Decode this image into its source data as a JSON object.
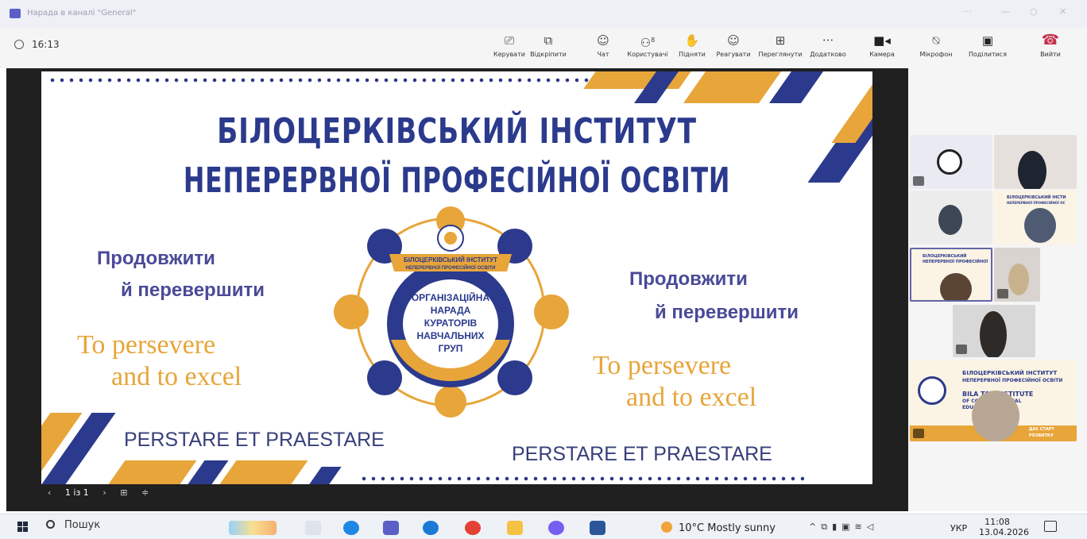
{
  "window": {
    "title": "Нарада в каналі \"General\""
  },
  "toolbar": {
    "timer": "16:13",
    "buttons": [
      {
        "id": "control",
        "label": "Керувати",
        "icon": "present-control-icon"
      },
      {
        "id": "popout",
        "label": "Відкріпити",
        "icon": "popout-icon"
      },
      {
        "id": "chat",
        "label": "Чат",
        "icon": "chat-icon"
      },
      {
        "id": "people",
        "label": "Користувачі",
        "icon": "people-icon",
        "badge": "8"
      },
      {
        "id": "raise",
        "label": "Підняти",
        "icon": "raise-hand-icon"
      },
      {
        "id": "react",
        "label": "Реагувати",
        "icon": "smiley-icon"
      },
      {
        "id": "view",
        "label": "Переглянути",
        "icon": "view-grid-icon"
      },
      {
        "id": "more",
        "label": "Додатково",
        "icon": "more-icon"
      },
      {
        "id": "camera",
        "label": "Камера",
        "icon": "camera-icon"
      },
      {
        "id": "mic",
        "label": "Мікрофон",
        "icon": "mic-off-icon"
      },
      {
        "id": "share",
        "label": "Поділитися",
        "icon": "share-icon"
      },
      {
        "id": "leave",
        "label": "Вийти",
        "icon": "hangup-icon"
      }
    ]
  },
  "slide": {
    "title_line1": "БІЛОЦЕРКІВСЬКИЙ  ІНСТИТУТ",
    "title_line2": "НЕПЕРЕРВНОЇ ПРОФЕСІЙНОЇ ОСВІТИ",
    "motto_ua_line1": "Продовжити",
    "motto_ua_line2": "й перевершити",
    "motto_en_line1": "To persevere",
    "motto_en_line2": "and to excel",
    "motto_la": "PERSTARE ET PRAESTARE",
    "emblem_banner_line1": "БІЛОЦЕРКІВСЬКИЙ ІНСТИТУТ",
    "emblem_banner_line2": "НЕПЕРЕРВНОЇ ПРОФЕСІЙНОЇ ОСВІТИ",
    "emblem_center_lines": [
      "ОРГАНІЗАЦІЙНА",
      "НАРАДА",
      "КУРАТОРІВ",
      "НАВЧАЛЬНИХ",
      "ГРУП"
    ],
    "colors": {
      "navy": "#2b3a8c",
      "orange": "#e7a53a"
    }
  },
  "slidenav": {
    "page": "1 із 1"
  },
  "participants": {
    "tiles": [
      {
        "kind": "avatar-icon"
      },
      {
        "kind": "video"
      },
      {
        "kind": "video"
      },
      {
        "kind": "shared-slide",
        "text_line1": "БІЛОЦЕРКІВСЬКИЙ ІНСТИ",
        "text_line2": "НЕПЕРЕРВНОЇ ПРОФЕСІЙНОЇ ОС"
      },
      {
        "kind": "shared-slide",
        "text_line1": "БІЛОЦЕРКІВСЬКИЙ",
        "text_line2": "НЕПЕРЕРВНОЇ ПРОФЕСІЙНОЇ"
      },
      {
        "kind": "video"
      },
      {
        "kind": "video"
      },
      {
        "kind": "shared-slide",
        "text_line1": "БІЛОЦЕРКІВСЬКИЙ ІНСТИТУТ",
        "text_line2": "НЕПЕРЕРВНОЇ ПРОФЕСІЙНОЇ ОСВІТИ",
        "text_line3": "BILA TSE INSTITUTE",
        "text_line4": "OF CO PROFESSIONAL",
        "text_line5": "EDUC",
        "text_line6": "ДАЄ СТАРТ",
        "text_line7": "РОЗВИТКУ"
      }
    ]
  },
  "taskbar": {
    "search_label": "Пошук",
    "weather": "10°C  Mostly sunny",
    "language": "УКР",
    "time": "11:08",
    "date": "13.04.2026"
  }
}
